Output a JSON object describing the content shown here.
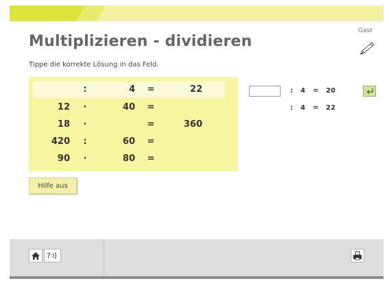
{
  "header": {
    "title": "Multiplizieren - dividieren",
    "instruction": "Tippe die korrekte Lösung in das Feld.",
    "user": "Gast"
  },
  "tasks": [
    {
      "a": "",
      "op": ":",
      "b": "4",
      "eq": "=",
      "r": "22"
    },
    {
      "a": "12",
      "op": "·",
      "b": "40",
      "eq": "=",
      "r": ""
    },
    {
      "a": "18",
      "op": "·",
      "b": "",
      "eq": "=",
      "r": "360"
    },
    {
      "a": "420",
      "op": ":",
      "b": "60",
      "eq": "=",
      "r": ""
    },
    {
      "a": "90",
      "op": "·",
      "b": "80",
      "eq": "=",
      "r": ""
    }
  ],
  "help_button": "Hilfe aus",
  "work_area": {
    "input_value": "",
    "lines": [
      {
        "op": ":",
        "b": "4",
        "eq": "=",
        "r": "20"
      },
      {
        "op": ":",
        "b": "4",
        "eq": "=",
        "r": "22"
      }
    ]
  },
  "icons": {
    "pen": "pen-icon",
    "home": "home-icon",
    "audio_help": "audio-help-icon",
    "print": "print-icon",
    "enter": "enter-icon"
  }
}
